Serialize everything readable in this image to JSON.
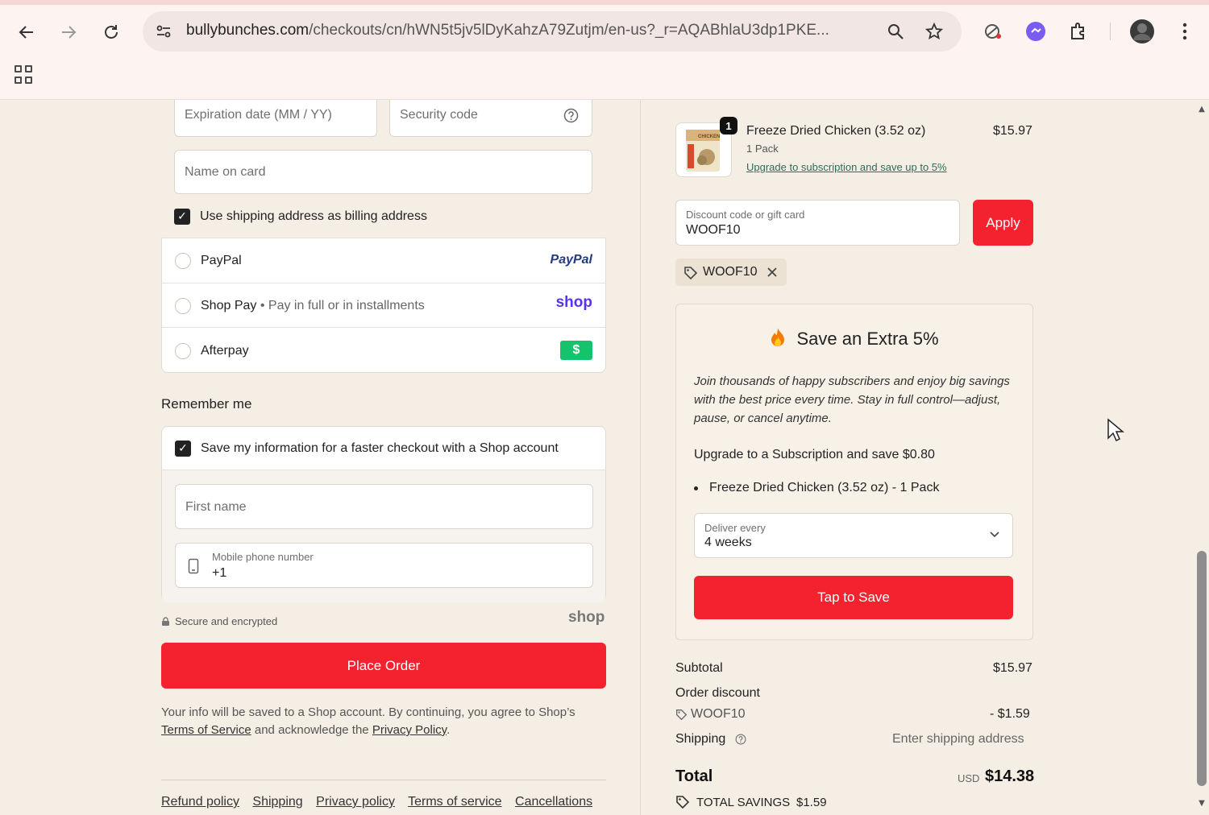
{
  "browser": {
    "url_domain": "bullybunches.com",
    "url_path": "/checkouts/cn/hWN5t5jv5lDyKahzA79Zutjm/en-us?_r=AQABhlaU3dp1PKE..."
  },
  "payment": {
    "expiration_placeholder": "Expiration date (MM / YY)",
    "security_placeholder": "Security code",
    "name_on_card_placeholder": "Name on card",
    "billing_same_label": "Use shipping address as billing address",
    "paypal_label": "PayPal",
    "paypal_logo": "PayPal",
    "shoppay_label": "Shop Pay",
    "shoppay_sub": "Pay in full or in installments",
    "shoppay_logo": "shop",
    "afterpay_label": "Afterpay",
    "afterpay_logo": "$"
  },
  "remember": {
    "heading": "Remember me",
    "save_info_label": "Save my information for a faster checkout with a Shop account",
    "first_name_placeholder": "First name",
    "phone_label": "Mobile phone number",
    "phone_value": "+1",
    "secure_label": "Secure and encrypted",
    "shop_logo": "shop"
  },
  "place_order_label": "Place Order",
  "legal": {
    "prefix": "Your info will be saved to a Shop account. By continuing, you agree to Shop’s",
    "terms_link": "Terms of Service",
    "middle": "and acknowledge the",
    "privacy_link": "Privacy Policy",
    "suffix": "."
  },
  "footer_links": [
    "Refund policy",
    "Shipping",
    "Privacy policy",
    "Terms of service",
    "Cancellations"
  ],
  "product": {
    "qty_badge": "1",
    "name": "Freeze Dried Chicken (3.52 oz)",
    "variant": "1 Pack",
    "upgrade_link": "Upgrade to subscription and save up to 5%",
    "price": "$15.97",
    "thumb_label": "CHICKEN"
  },
  "discount": {
    "label": "Discount code or gift card",
    "value": "WOOF10",
    "apply_label": "Apply",
    "tag": "WOOF10"
  },
  "subscribe": {
    "title": "Save an Extra 5%",
    "body": "Join thousands of happy subscribers and enjoy big savings with the best price every time. Stay in full control—adjust, pause, or cancel anytime.",
    "upgrade_text": "Upgrade to a Subscription and save $0.80",
    "item": "Freeze Dried Chicken (3.52 oz) - 1 Pack",
    "deliver_label": "Deliver every",
    "deliver_value": "4 weeks",
    "tap_label": "Tap to Save"
  },
  "summary": {
    "subtotal_label": "Subtotal",
    "subtotal_value": "$15.97",
    "order_discount_label": "Order discount",
    "discount_code": "WOOF10",
    "discount_value": "- $1.59",
    "shipping_label": "Shipping",
    "shipping_value": "Enter shipping address",
    "total_label": "Total",
    "currency": "USD",
    "total_value": "$14.38",
    "savings_label": "TOTAL SAVINGS",
    "savings_value": "$1.59"
  }
}
